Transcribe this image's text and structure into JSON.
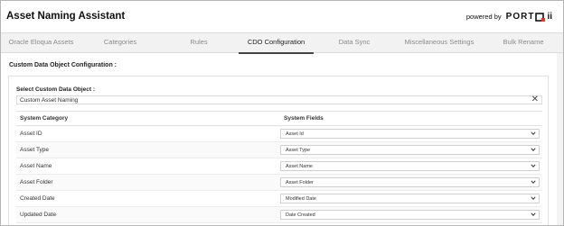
{
  "header": {
    "title": "Asset Naming Assistant",
    "powered_by": "powered by",
    "logo_text": "PORT",
    "logo_suffix": "ii",
    "logo_icon": "port-logo-square-icon"
  },
  "tabs": [
    {
      "label": "Oracle Eloqua Assets",
      "active": false
    },
    {
      "label": "Categories",
      "active": false
    },
    {
      "label": "Rules",
      "active": false
    },
    {
      "label": "CDO Configuration",
      "active": true
    },
    {
      "label": "Data Sync",
      "active": false
    },
    {
      "label": "Miscellaneous Settings",
      "active": false
    },
    {
      "label": "Bulk Rename",
      "active": false
    }
  ],
  "section": {
    "title": "Custom Data Object Configuration :",
    "select_label": "Select Custom Data Object :",
    "selected_value": "Custom Asset Naming",
    "clear_icon": "close-icon"
  },
  "table": {
    "headers": [
      "System Category",
      "System Fields"
    ],
    "rows": [
      {
        "category": "Asset ID",
        "field": "Asset Id"
      },
      {
        "category": "Asset Type",
        "field": "Asset Type"
      },
      {
        "category": "Asset Name",
        "field": "Asset Name"
      },
      {
        "category": "Asset Folder",
        "field": "Asset Folder"
      },
      {
        "category": "Created Date",
        "field": "Modified Date"
      },
      {
        "category": "Updated Date",
        "field": "Date Created"
      }
    ]
  },
  "colors": {
    "accent": "#e8332a",
    "active_tab_underline": "#444444",
    "tab_bar": "#f2f2f2"
  }
}
